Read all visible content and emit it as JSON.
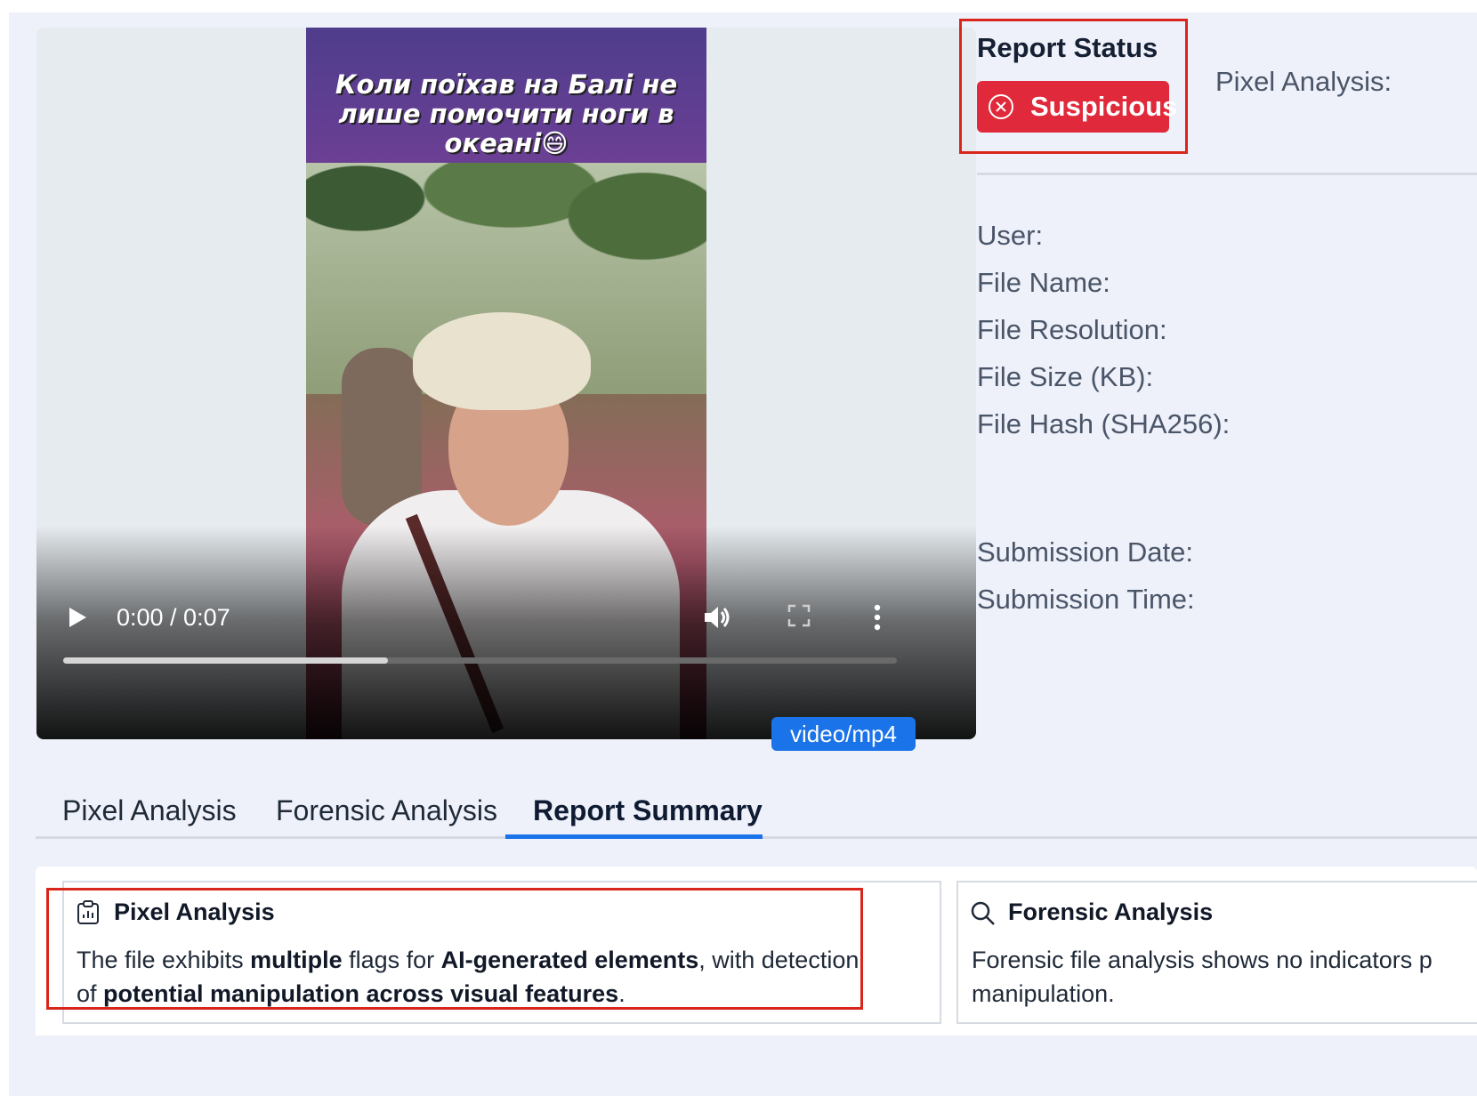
{
  "video": {
    "caption": "Коли поїхав на Балі не лише помочити ноги в океані😄",
    "time": "0:00 / 0:07",
    "progress_fraction": 0.39,
    "mime_type": "video/mp4",
    "icons": {
      "play": "play-icon",
      "volume": "volume-icon",
      "fullscreen": "fullscreen-icon",
      "more": "more-vertical-icon"
    }
  },
  "report_status": {
    "title": "Report Status",
    "status_label": "Suspicious",
    "status_icon": "x-circle-icon",
    "status_color": "#e0293a",
    "highlight_color": "#d9261c"
  },
  "pixel_analysis_label": "Pixel Analysis:",
  "metadata": {
    "user": "User:",
    "file_name": "File Name:",
    "file_resolution": "File Resolution:",
    "file_size": "File Size (KB):",
    "file_hash": "File Hash (SHA256):",
    "submission_date": "Submission Date:",
    "submission_time": "Submission Time:"
  },
  "tabs": [
    {
      "label": "Pixel Analysis",
      "active": false
    },
    {
      "label": "Forensic Analysis",
      "active": false
    },
    {
      "label": "Report Summary",
      "active": true
    }
  ],
  "accent_color": "#1a73e8",
  "summary": {
    "pixel": {
      "title": "Pixel Analysis",
      "icon": "clipboard-chart-icon",
      "text_parts": [
        {
          "t": "The file exhibits ",
          "b": false
        },
        {
          "t": "multiple",
          "b": true
        },
        {
          "t": " flags for ",
          "b": false
        },
        {
          "t": "AI-generated elements",
          "b": true
        },
        {
          "t": ", with detection of ",
          "b": false
        },
        {
          "t": "potential manipulation across visual features",
          "b": true
        },
        {
          "t": ".",
          "b": false
        }
      ]
    },
    "forensic": {
      "title": "Forensic Analysis",
      "icon": "search-icon",
      "text": "Forensic file analysis shows no indicators p manipulation."
    }
  }
}
